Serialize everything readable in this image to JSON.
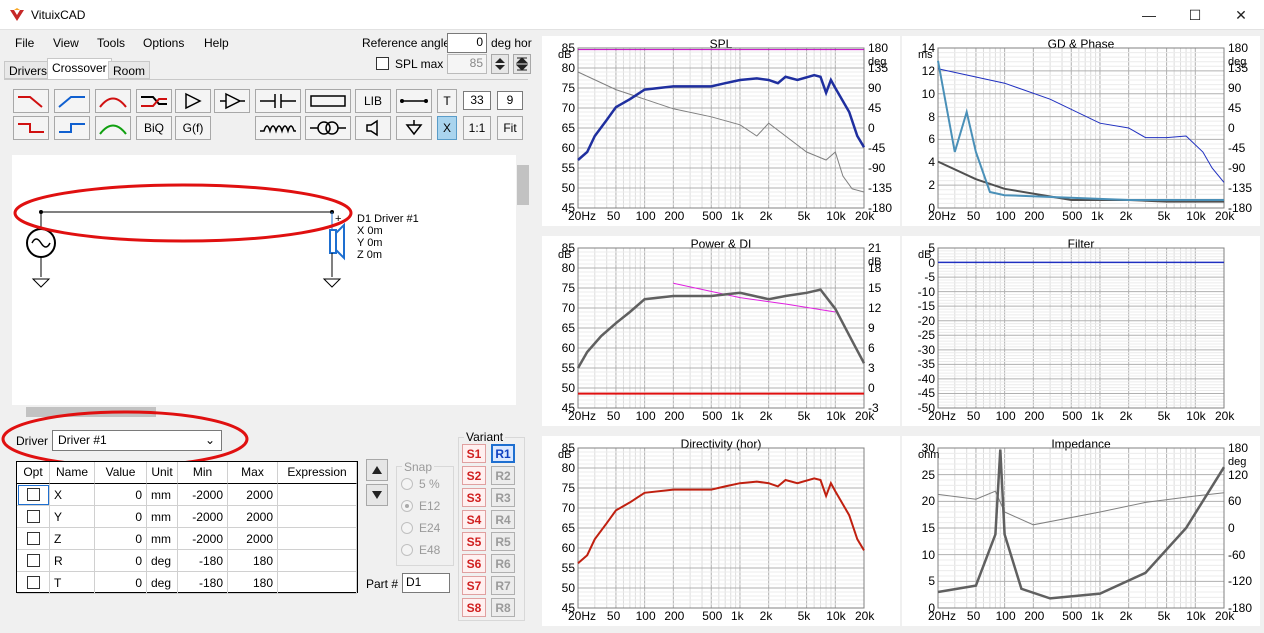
{
  "window": {
    "title": "VituixCAD",
    "min": "—",
    "max": "☐",
    "close": "✕"
  },
  "menu": [
    "File",
    "View",
    "Tools",
    "Options",
    "Help"
  ],
  "ref_angle": {
    "label": "Reference angle",
    "value": "0",
    "unit": "deg hor"
  },
  "spl_max": {
    "label": "SPL max",
    "value": "85"
  },
  "tabs": [
    "Drivers",
    "Crossover",
    "Room"
  ],
  "toolbar": {
    "biq": "BiQ",
    "gf": "G(f)",
    "lib": "LIB",
    "t": "T",
    "val1": "33",
    "val2": "9",
    "x": "X",
    "ratio": "1:1",
    "fit": "Fit"
  },
  "schematic": {
    "driver_name": "D1 Driver #1",
    "x": "X 0m",
    "y": "Y 0m",
    "z": "Z 0m",
    "plus": "+",
    "minus": "-"
  },
  "driver_select": {
    "label": "Driver",
    "value": "Driver #1"
  },
  "table": {
    "headers": [
      "Opt",
      "Name",
      "Value",
      "Unit",
      "Min",
      "Max",
      "Expression"
    ],
    "rows": [
      [
        "X",
        "0",
        "mm",
        "-2000",
        "2000"
      ],
      [
        "Y",
        "0",
        "mm",
        "-2000",
        "2000"
      ],
      [
        "Z",
        "0",
        "mm",
        "-2000",
        "2000"
      ],
      [
        "R",
        "0",
        "deg",
        "-180",
        "180"
      ],
      [
        "T",
        "0",
        "deg",
        "-180",
        "180"
      ]
    ]
  },
  "snap": {
    "label": "Snap",
    "options": [
      "5 %",
      "E12",
      "E24",
      "E48"
    ]
  },
  "part": {
    "label": "Part #",
    "value": "D1"
  },
  "variant": {
    "label": "Variant",
    "s": [
      "S1",
      "S2",
      "S3",
      "S4",
      "S5",
      "S6",
      "S7",
      "S8"
    ],
    "r": [
      "R1",
      "R2",
      "R3",
      "R4",
      "R5",
      "R6",
      "R7",
      "R8"
    ]
  },
  "xticks": [
    "20Hz",
    "50",
    "100",
    "200",
    "500",
    "1k",
    "2k",
    "5k",
    "10k",
    "20k"
  ],
  "plots": {
    "spl": {
      "title": "SPL",
      "ly": [
        "85",
        "80",
        "75",
        "70",
        "65",
        "60",
        "55",
        "50",
        "45"
      ],
      "ry": [
        "180",
        "135",
        "90",
        "45",
        "0",
        "-45",
        "-90",
        "-135",
        "-180"
      ],
      "lunit": "dB",
      "runit": "deg"
    },
    "gd": {
      "title": "GD & Phase",
      "ly": [
        "14",
        "12",
        "10",
        "8",
        "6",
        "4",
        "2",
        "0"
      ],
      "ry": [
        "180",
        "135",
        "90",
        "45",
        "0",
        "-45",
        "-90",
        "-135",
        "-180"
      ],
      "lunit": "ms",
      "runit": "deg"
    },
    "power": {
      "title": "Power & DI",
      "ly": [
        "85",
        "80",
        "75",
        "70",
        "65",
        "60",
        "55",
        "50",
        "45"
      ],
      "ry": [
        "21",
        "18",
        "15",
        "12",
        "9",
        "6",
        "3",
        "0",
        "-3"
      ],
      "lunit": "dB",
      "runit": "dB"
    },
    "filter": {
      "title": "Filter",
      "ly": [
        "5",
        "0",
        "-5",
        "-10",
        "-15",
        "-20",
        "-25",
        "-30",
        "-35",
        "-40",
        "-45",
        "-50"
      ],
      "lunit": "dB"
    },
    "directivity": {
      "title": "Directivity (hor)",
      "ly": [
        "85",
        "80",
        "75",
        "70",
        "65",
        "60",
        "55",
        "50",
        "45"
      ],
      "lunit": "dB"
    },
    "impedance": {
      "title": "Impedance",
      "ly": [
        "30",
        "25",
        "20",
        "15",
        "10",
        "5",
        "0"
      ],
      "ry": [
        "180",
        "120",
        "60",
        "0",
        "-60",
        "-120",
        "-180"
      ],
      "lunit": "ohm",
      "runit": "deg"
    }
  }
}
